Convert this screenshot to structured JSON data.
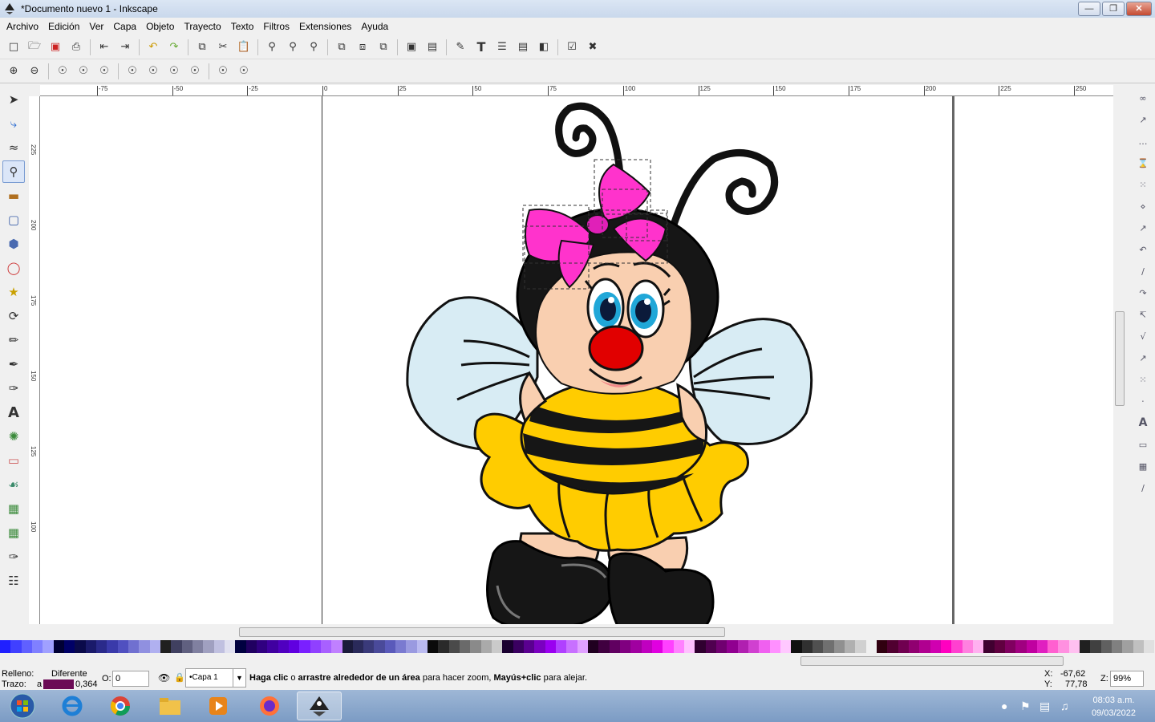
{
  "window": {
    "title": "*Documento nuevo 1 - Inkscape",
    "controls": [
      "minimize",
      "maximize",
      "close"
    ]
  },
  "menu": [
    "Archivo",
    "Edición",
    "Ver",
    "Capa",
    "Objeto",
    "Trayecto",
    "Texto",
    "Filtros",
    "Extensiones",
    "Ayuda"
  ],
  "toolbar1": [
    "new-icon",
    "open-icon",
    "save-icon",
    "print-icon",
    "import-icon",
    "export-icon",
    "undo-icon",
    "redo-icon",
    "copy-icon",
    "cut-icon",
    "paste-icon",
    "zoom-selection-icon",
    "zoom-drawing-icon",
    "zoom-page-icon",
    "duplicate-icon",
    "clone-icon",
    "unlink-clone-icon",
    "group-icon",
    "ungroup-icon",
    "fill-stroke-icon",
    "text-font-icon",
    "layers-icon",
    "xml-editor-icon",
    "align-icon",
    "preferences-icon",
    "document-properties-icon"
  ],
  "toolbar2": [
    "zoom-in-icon",
    "zoom-out-icon",
    "zoom-1-1-icon",
    "zoom-1-2-icon",
    "zoom-2-1-icon",
    "zoom-selection-icon",
    "zoom-drawing-icon",
    "zoom-page-icon",
    "zoom-page-width-icon",
    "zoom-previous-icon",
    "zoom-next-icon"
  ],
  "tools": [
    "selector-tool",
    "node-tool",
    "tweak-tool",
    "zoom-tool",
    "measure-tool",
    "rectangle-tool",
    "3d-box-tool",
    "ellipse-tool",
    "star-tool",
    "spiral-tool",
    "pencil-tool",
    "pen-tool",
    "calligraphy-tool",
    "text-tool",
    "spray-tool",
    "eraser-tool",
    "paint-bucket-tool",
    "gradient-tool",
    "mesh-tool",
    "dropper-tool",
    "connector-tool"
  ],
  "active_tool": "zoom-tool",
  "ruler": {
    "h_labels": [
      "-75",
      "-50",
      "-25",
      "0",
      "25",
      "50",
      "75",
      "100",
      "125",
      "150",
      "175",
      "200",
      "225",
      "250"
    ],
    "v_labels": [
      "225",
      "200",
      "175",
      "150",
      "125",
      "100"
    ]
  },
  "palette_colors": [
    "#2020ff",
    "#4040ff",
    "#6060ff",
    "#8080ff",
    "#a0a0ff",
    "#000033",
    "#000066",
    "#0a0a4a",
    "#1a1a6a",
    "#2a2a8a",
    "#3a3aaa",
    "#5050c0",
    "#7070d0",
    "#9090e0",
    "#b0b0f0",
    "#202020",
    "#404060",
    "#606080",
    "#8080a0",
    "#a0a0c0",
    "#c0c0e0",
    "#e0e0f0",
    "#000040",
    "#200060",
    "#300080",
    "#4000a0",
    "#5000c0",
    "#6000e0",
    "#7a20ff",
    "#9040ff",
    "#a860ff",
    "#c080ff",
    "#1a1a3a",
    "#2a2a5a",
    "#3a3a7a",
    "#4a4a9a",
    "#5a5aba",
    "#7a7ad0",
    "#9a9ae0",
    "#babaf0",
    "#0a0a0a",
    "#2a2a2a",
    "#4a4a4a",
    "#6a6a6a",
    "#8a8a8a",
    "#aaaaaa",
    "#cacaca",
    "#1a0030",
    "#3a0060",
    "#5a0090",
    "#7a00c0",
    "#9a00f0",
    "#b040ff",
    "#c870ff",
    "#e0a0ff",
    "#200020",
    "#400040",
    "#600060",
    "#800080",
    "#a000a0",
    "#c000c0",
    "#e000e0",
    "#ff40ff",
    "#ff80ff",
    "#ffc0ff",
    "#300030",
    "#500050",
    "#700070",
    "#900090",
    "#b020b0",
    "#d040d0",
    "#f060f0",
    "#ff90ff",
    "#ffc8ff",
    "#101010",
    "#303030",
    "#505050",
    "#707070",
    "#909090",
    "#b0b0b0",
    "#d0d0d0",
    "#f0f0f0",
    "#300010",
    "#500030",
    "#700050",
    "#900070",
    "#b00090",
    "#d000b0",
    "#ff00c0",
    "#ff40d0",
    "#ff80e0",
    "#ffb0f0",
    "#400030",
    "#600040",
    "#800060",
    "#a00080",
    "#c000a0",
    "#e020c0",
    "#ff60d0",
    "#ff90e0",
    "#ffc0f0",
    "#202020",
    "#404040",
    "#606060",
    "#808080",
    "#a0a0a0",
    "#c0c0c0",
    "#e0e0e0"
  ],
  "status": {
    "fill_label": "Relleno:",
    "fill_value": "Diferente",
    "stroke_label": "Trazo:",
    "stroke_prefix": "a",
    "stroke_width": "0,364",
    "opacity_label": "O:",
    "opacity_value": "0",
    "layer": "•Capa 1",
    "message_bold1": "Haga clic",
    "message_t1": " o ",
    "message_bold2": "arrastre alrededor de un área",
    "message_t2": " para hacer zoom, ",
    "message_bold3": "Mayús+clic",
    "message_t3": " para alejar.",
    "x_label": "X:",
    "x_value": "-67,62",
    "y_label": "Y:",
    "y_value": "77,78",
    "zoom_label": "Z:",
    "zoom_value": "99%"
  },
  "taskbar": {
    "apps": [
      "start-button",
      "internet-explorer-icon",
      "chrome-icon",
      "file-explorer-icon",
      "media-player-icon",
      "firefox-icon",
      "inkscape-icon"
    ],
    "active_app": "inkscape-icon",
    "time": "08:03 a.m.",
    "date": "09/03/2022"
  }
}
